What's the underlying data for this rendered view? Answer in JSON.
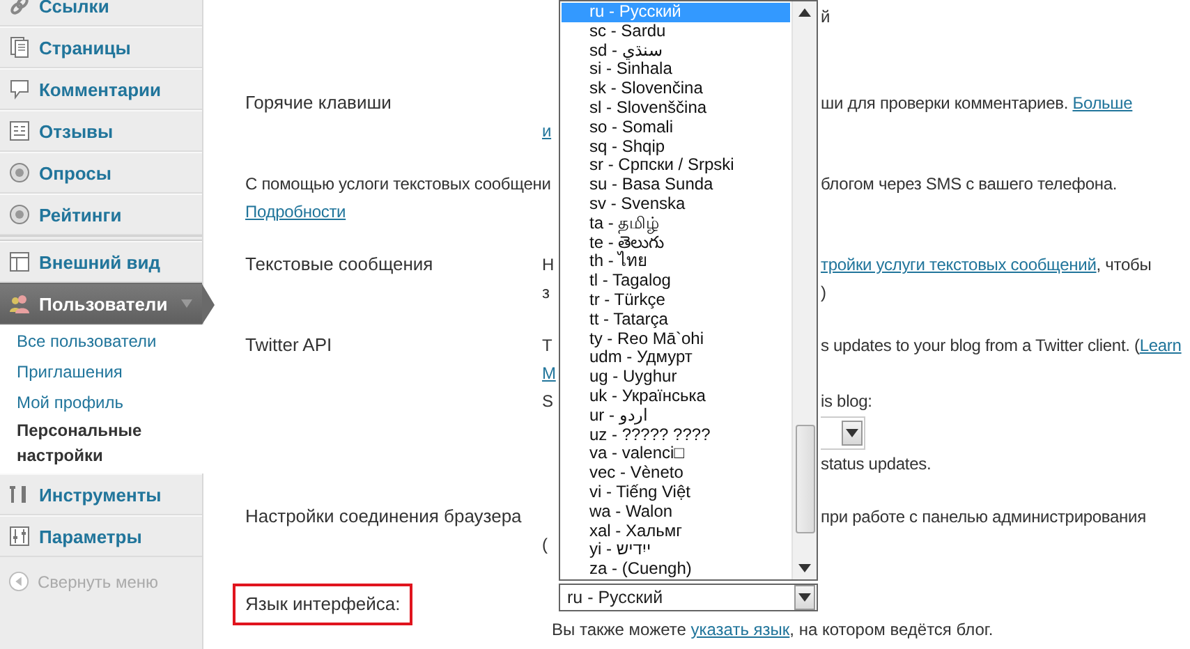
{
  "sidebar": {
    "groups": [
      [
        {
          "label": "Ссылки",
          "selected": false
        },
        {
          "label": "Страницы",
          "selected": false
        },
        {
          "label": "Комментарии",
          "selected": false
        },
        {
          "label": "Отзывы",
          "selected": false
        },
        {
          "label": "Опросы",
          "selected": false
        },
        {
          "label": "Рейтинги",
          "selected": false
        }
      ],
      [
        {
          "label": "Внешний вид",
          "selected": false
        },
        {
          "label": "Пользователи",
          "selected": true,
          "submenu": [
            {
              "label": "Все пользователи",
              "selected": false
            },
            {
              "label": "Приглашения",
              "selected": false
            },
            {
              "label": "Мой профиль",
              "selected": false
            },
            {
              "label": "Персональные настройки",
              "selected": true
            }
          ]
        },
        {
          "label": "Инструменты",
          "selected": false
        },
        {
          "label": "Параметры",
          "selected": false
        }
      ]
    ],
    "collapse": "Свернуть меню"
  },
  "settings": [
    {
      "kind": "field",
      "lines": [
        {
          "right": [
            {
              "text": "й"
            }
          ]
        }
      ]
    },
    {
      "kind": "field",
      "label": "Горячие клавиши",
      "lines": [
        {
          "right": [
            {
              "text": "ши для проверки комментариев. "
            },
            {
              "text": "Больше",
              "link": true
            }
          ]
        },
        {
          "left": [
            {
              "text": "и",
              "link": true
            }
          ]
        }
      ]
    },
    {
      "kind": "note",
      "lines": [
        {
          "left": [
            {
              "text": "С помощью услоги текстовых сообщени"
            }
          ],
          "right": [
            {
              "text": "блогом через SMS с вашего телефона."
            }
          ]
        },
        {
          "left": [
            {
              "text": "Подробности",
              "link": true
            }
          ]
        }
      ]
    },
    {
      "kind": "field",
      "label": "Текстовые сообщения",
      "lines": [
        {
          "left": [
            {
              "text": "Н"
            }
          ],
          "right": [
            {
              "text": "тройки услуги текстовых сообщений",
              "link": true
            },
            {
              "text": ", чтобы"
            }
          ]
        },
        {
          "left": [
            {
              "text": "з"
            }
          ],
          "right": [
            {
              "text": ")"
            }
          ]
        }
      ]
    },
    {
      "kind": "field",
      "label": "Twitter API",
      "lines": [
        {
          "left": [
            {
              "text": "T"
            }
          ],
          "right": [
            {
              "text": "s updates to your blog from a Twitter client. ("
            },
            {
              "text": "Learn",
              "link": true
            }
          ]
        },
        {
          "left": [
            {
              "text": "M",
              "link": true
            }
          ]
        },
        {
          "left": [
            {
              "text": "S"
            }
          ],
          "right": [
            {
              "text": "is blog:"
            }
          ]
        },
        {
          "select": true
        },
        {
          "right": [
            {
              "text": "status updates."
            }
          ]
        }
      ]
    },
    {
      "kind": "field",
      "label": "Настройки соединения браузера",
      "lines": [
        {
          "right": [
            {
              "text": "при работе с панелью администрирования"
            }
          ]
        },
        {
          "left": [
            {
              "text": "("
            }
          ]
        }
      ]
    }
  ],
  "language": {
    "label": "Язык интерфейса:",
    "highlighted": true,
    "value": "ru - Русский",
    "expanded": true,
    "options": [
      {
        "label": "ru - Русский",
        "selected": true
      },
      {
        "label": "sc - Sardu",
        "selected": false
      },
      {
        "label": "sd - سنڌي",
        "selected": false
      },
      {
        "label": "si - Sinhala",
        "selected": false
      },
      {
        "label": "sk - Slovenčina",
        "selected": false
      },
      {
        "label": "sl - Slovenščina",
        "selected": false
      },
      {
        "label": "so - Somali",
        "selected": false
      },
      {
        "label": "sq - Shqip",
        "selected": false
      },
      {
        "label": "sr - Српски / Srpski",
        "selected": false
      },
      {
        "label": "su - Basa Sunda",
        "selected": false
      },
      {
        "label": "sv - Svenska",
        "selected": false
      },
      {
        "label": "ta - தமிழ்",
        "selected": false
      },
      {
        "label": "te - తెలుగు",
        "selected": false
      },
      {
        "label": "th - ไทย",
        "selected": false
      },
      {
        "label": "tl - Tagalog",
        "selected": false
      },
      {
        "label": "tr - Türkçe",
        "selected": false
      },
      {
        "label": "tt - Tatarça",
        "selected": false
      },
      {
        "label": "ty - Reo Mā`ohi",
        "selected": false
      },
      {
        "label": "udm - Удмурт",
        "selected": false
      },
      {
        "label": "ug - Uyghur",
        "selected": false
      },
      {
        "label": "uk - Українська",
        "selected": false
      },
      {
        "label": "ur - اردو",
        "selected": false
      },
      {
        "label": "uz - ????? ????",
        "selected": false
      },
      {
        "label": "va - valenci□",
        "selected": false
      },
      {
        "label": "vec - Vèneto",
        "selected": false
      },
      {
        "label": "vi - Tiếng Việt",
        "selected": false
      },
      {
        "label": "wa - Walon",
        "selected": false
      },
      {
        "label": "xal - Хальмг",
        "selected": false
      },
      {
        "label": "yi - ייִדיש",
        "selected": false
      },
      {
        "label": "za - (Cuengh)",
        "selected": false
      }
    ],
    "hint": [
      {
        "text": "Вы также можете "
      },
      {
        "text": "указать язык",
        "link": true
      },
      {
        "text": ", на котором ведётся блог."
      }
    ]
  }
}
